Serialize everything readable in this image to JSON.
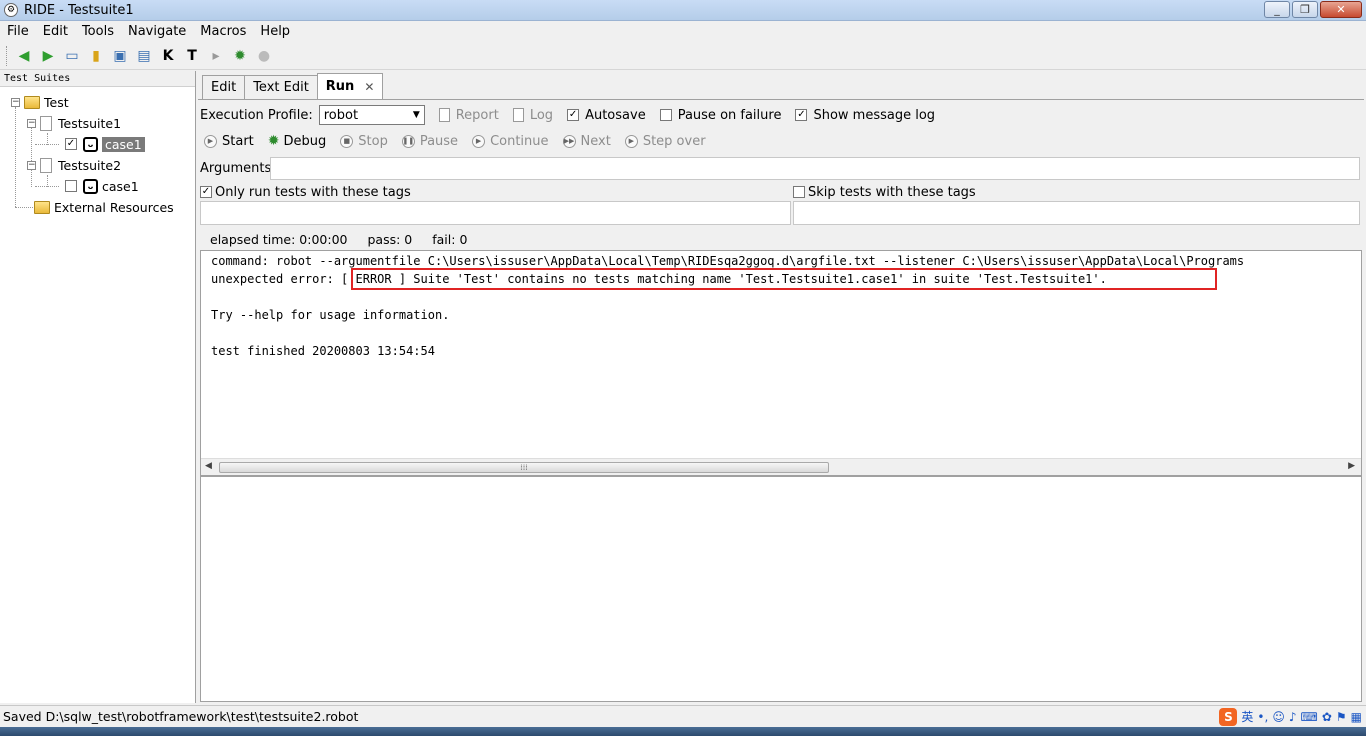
{
  "window": {
    "title": "RIDE - Testsuite1"
  },
  "menu": [
    "File",
    "Edit",
    "Tools",
    "Navigate",
    "Macros",
    "Help"
  ],
  "tree": {
    "header": "Test Suites",
    "root": "Test",
    "suite1": "Testsuite1",
    "suite1_case": "case1",
    "suite2": "Testsuite2",
    "suite2_case": "case1",
    "external": "External Resources"
  },
  "tabs": {
    "edit": "Edit",
    "text_edit": "Text Edit",
    "run": "Run"
  },
  "run": {
    "profile_label": "Execution Profile:",
    "profile_value": "robot",
    "report": "Report",
    "log": "Log",
    "autosave": "Autosave",
    "pause_on_failure": "Pause on failure",
    "show_message_log": "Show message log",
    "start": "Start",
    "debug": "Debug",
    "stop": "Stop",
    "pause": "Pause",
    "continue": "Continue",
    "next": "Next",
    "step_over": "Step over",
    "arguments_label": "Arguments:",
    "only_run_tags": "Only run tests with these tags",
    "skip_tags": "Skip tests with these tags",
    "elapsed": "elapsed time: 0:00:00",
    "pass": "pass: 0",
    "fail": "fail: 0"
  },
  "output": {
    "line1": "command: robot --argumentfile C:\\Users\\issuser\\AppData\\Local\\Temp\\RIDEsqa2ggoq.d\\argfile.txt --listener C:\\Users\\issuser\\AppData\\Local\\Programs",
    "line2": "unexpected error: [ ERROR ] Suite 'Test' contains no tests matching name 'Test.Testsuite1.case1' in suite 'Test.Testsuite1'.",
    "line3": "",
    "line4": "Try --help for usage information.",
    "line5": "",
    "line6": "test finished 20200803 13:54:54"
  },
  "status": {
    "text": "Saved D:\\sqlw_test\\robotframework\\test\\testsuite2.robot"
  },
  "ime": {
    "lang": "英"
  },
  "colors": {
    "error_box": "#e02424",
    "selection": "#7a7a7a"
  }
}
